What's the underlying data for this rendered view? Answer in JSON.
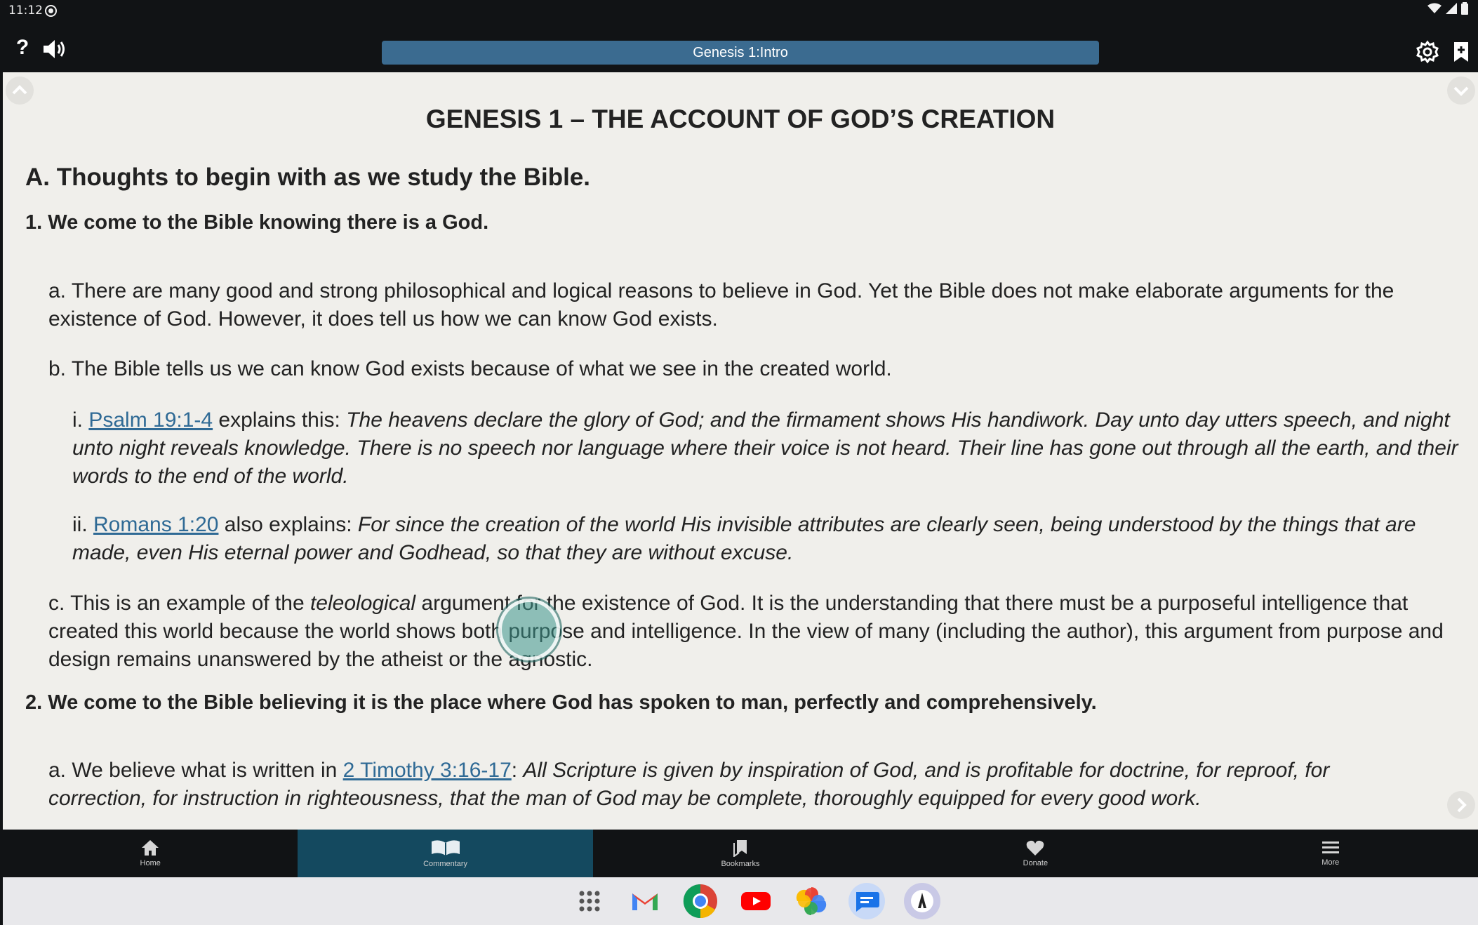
{
  "status_bar": {
    "time": "11:12"
  },
  "header": {
    "chapter_title": "Genesis 1:Intro"
  },
  "document": {
    "title": "GENESIS 1 – THE ACCOUNT OF GOD’S CREATION",
    "section_a": "A. Thoughts to begin with as we study the Bible.",
    "point_1": "1. We come to the Bible knowing there is a God.",
    "p1a": "a. There are many good and strong philosophical and logical reasons to believe in God. Yet the Bible does not make elaborate arguments for the existence of God. However, it does tell us how we can know God exists.",
    "p1b": "b. The Bible tells us we can know God exists because of what we see in the created world.",
    "p1b_i": {
      "prefix": "i. ",
      "link": "Psalm 19:1-4",
      "mid": " explains this: ",
      "quote": "The heavens declare the glory of God; and the firmament shows His handiwork. Day unto day utters speech, and night unto night reveals knowledge. There is no speech nor language where their voice is not heard. Their line has gone out through all the earth, and their words to the end of the world."
    },
    "p1b_ii": {
      "prefix": "ii. ",
      "link": "Romans 1:20",
      "mid": " also explains: ",
      "quote": "For since the creation of the world His invisible attributes are clearly seen, being understood by the things that are made, even His eternal power and Godhead, so that they are without excuse."
    },
    "p1c": {
      "before": "c. This is an example of the ",
      "italic": "teleological",
      "after": " argument for the existence of God. It is the understanding that there must be a purposeful intelligence that created this world because the world shows both purpose and intelligence. In the view of many (including the author), this argument from purpose and design remains unanswered by the atheist or the agnostic."
    },
    "point_2": "2. We come to the Bible believing it is the place where God has spoken to man, perfectly and comprehensively.",
    "p2a": {
      "before": "a. We believe what is written in ",
      "link": "2 Timothy 3:16-17",
      "mid": ": ",
      "quote": "All Scripture is given by inspiration of God, and is profitable for doctrine, for reproof, for correction, for instruction in righteousness, that the man of God may be complete, thoroughly equipped for every good work."
    }
  },
  "bottom_nav": {
    "items": [
      {
        "label": "Home",
        "icon": "home-icon"
      },
      {
        "label": "Commentary",
        "icon": "open-book-icon"
      },
      {
        "label": "Bookmarks",
        "icon": "bookmarks-icon"
      },
      {
        "label": "Donate",
        "icon": "heart-icon"
      },
      {
        "label": "More",
        "icon": "menu-icon"
      }
    ],
    "active": "Commentary"
  },
  "dock": {
    "apps": [
      "app-drawer-icon",
      "gmail-icon",
      "chrome-icon",
      "youtube-icon",
      "photos-icon",
      "messages-icon",
      "app-icon"
    ]
  },
  "colors": {
    "title_bar": "#3b6b90",
    "link": "#2f6a95",
    "nav_active": "#14495f",
    "page_bg": "#f0efeb"
  }
}
